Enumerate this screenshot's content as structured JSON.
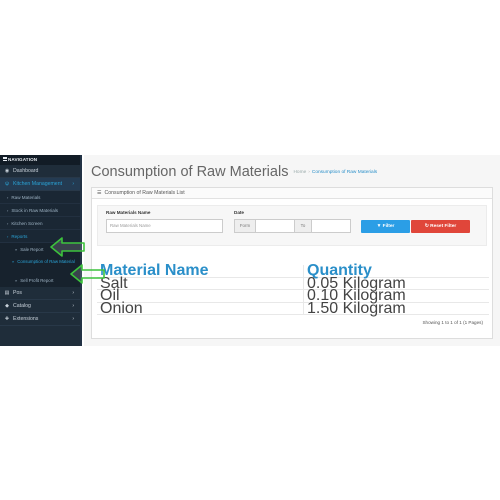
{
  "sidebar": {
    "header": "NAVIGATION",
    "items": [
      {
        "label": "Dashboard",
        "icon": "dashboard-icon",
        "glyph": "◉"
      },
      {
        "label": "Kitchen Management",
        "icon": "cutlery-icon",
        "glyph": "ψ"
      }
    ],
    "kitchen_sub": [
      {
        "label": "Raw Materials"
      },
      {
        "label": "Stock in Raw Materials"
      },
      {
        "label": "Kitchen Screen"
      },
      {
        "label": "Reports"
      }
    ],
    "report_sub": [
      {
        "label": "Sale Report"
      },
      {
        "label": "Consumption of Raw Material"
      },
      {
        "label": "Sell Profit Report"
      }
    ],
    "bottom_items": [
      {
        "label": "Pos",
        "icon": "cart-icon",
        "glyph": "▤"
      },
      {
        "label": "Catalog",
        "icon": "tag-icon",
        "glyph": "◆"
      },
      {
        "label": "Extensions",
        "icon": "puzzle-icon",
        "glyph": "✚"
      }
    ]
  },
  "header": {
    "title": "Consumption of Raw Materials",
    "breadcrumb_home": "Home",
    "breadcrumb_sep": "›",
    "breadcrumb_current": "Consumption of Raw Materials"
  },
  "panel": {
    "title": "Consumption of Raw Materials List"
  },
  "filter": {
    "name_label": "Raw Materials Name",
    "name_placeholder": "Raw Materials Name",
    "date_label": "Date",
    "from_label": "Form",
    "to_label": "To",
    "filter_button": "Filter",
    "reset_button": "Reset Filter"
  },
  "table": {
    "columns": [
      "Material Name",
      "Quantity"
    ],
    "rows": [
      {
        "name": "Salt",
        "quantity": "0.05 Kilogram"
      },
      {
        "name": "Oil",
        "quantity": "0.10 Kilogram"
      },
      {
        "name": "Onion",
        "quantity": "1.50 Kilogram"
      }
    ]
  },
  "pagination": {
    "text": "Showing 1 to 1 of 1 (1 Pages)"
  },
  "colors": {
    "sidebar_bg": "#1f2d3a",
    "accent": "#2aa3d6",
    "filter_button": "#2b9ee6",
    "reset_button": "#e0463a",
    "annotation_arrow": "#3cc23c"
  }
}
